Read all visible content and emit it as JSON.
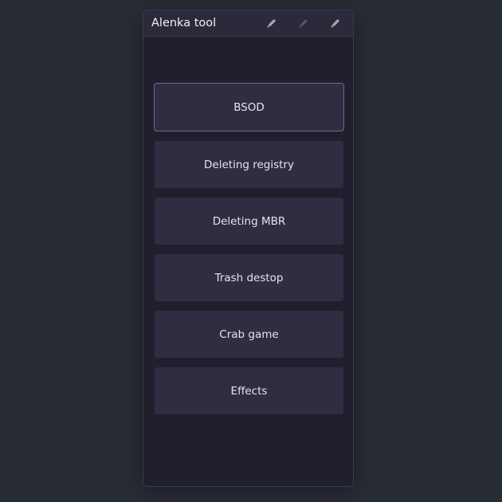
{
  "window": {
    "title": "Alenka tool"
  },
  "titlebar_buttons": [
    {
      "icon": "pencil-icon",
      "role": "minimize",
      "color": "#a9a9b3"
    },
    {
      "icon": "pencil-icon",
      "role": "maximize",
      "color": "#54546a"
    },
    {
      "icon": "pencil-icon",
      "role": "close",
      "color": "#a9a9b3"
    }
  ],
  "buttons": [
    {
      "label": "BSOD",
      "focused": true
    },
    {
      "label": "Deleting registry",
      "focused": false
    },
    {
      "label": "Deleting MBR",
      "focused": false
    },
    {
      "label": "Trash destop",
      "focused": false
    },
    {
      "label": "Crab game",
      "focused": false
    },
    {
      "label": "Effects",
      "focused": false
    }
  ],
  "colors": {
    "desktop": "#282c35",
    "window_bg": "#1f1f2d",
    "titlebar_bg": "#2b2a3b",
    "button_bg": "#302d42",
    "focus_border": "#6d6c82",
    "text": "#e4e4ea"
  }
}
